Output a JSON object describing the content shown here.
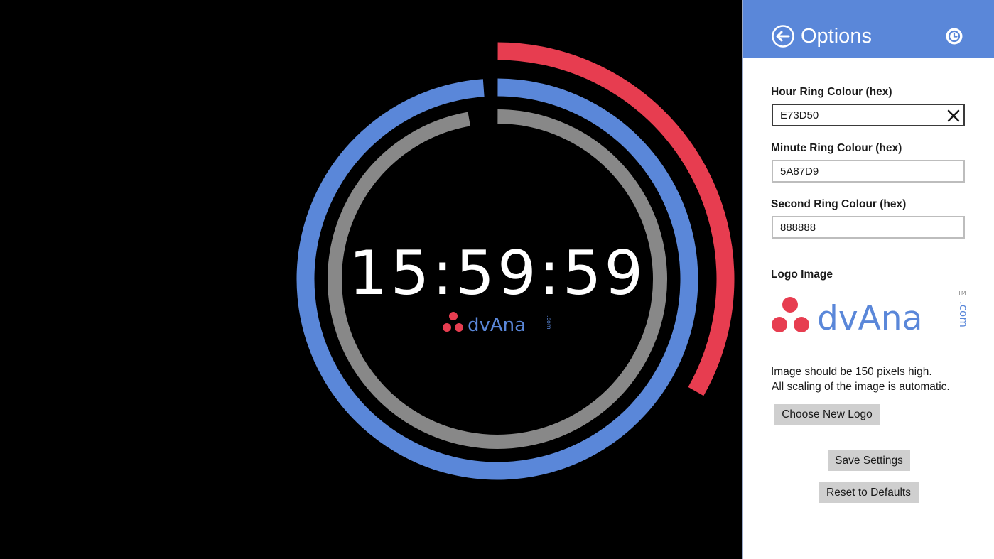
{
  "clock": {
    "time": "15:59:59",
    "hours": 15,
    "minutes": 59,
    "seconds": 59,
    "logo": {
      "mark": "dvAna",
      "suffix": ".com",
      "tm": "TM"
    }
  },
  "colors": {
    "hour_ring": "#E73D50",
    "minute_ring": "#5A87D9",
    "second_ring": "#888888",
    "header_bg": "#5A87D9",
    "logo_dots": "#E73D50",
    "logo_text": "#5A87D9"
  },
  "options": {
    "title": "Options",
    "back_icon": "back-arrow-icon",
    "clock_icon": "clock-icon",
    "hour_ring": {
      "label": "Hour Ring Colour (hex)",
      "value": "E73D50"
    },
    "minute_ring": {
      "label": "Minute Ring Colour (hex)",
      "value": "5A87D9"
    },
    "second_ring": {
      "label": "Second Ring Colour (hex)",
      "value": "888888"
    },
    "logo_image_label": "Logo Image",
    "help_line1": "Image should be 150 pixels high.",
    "help_line2": "All scaling of the image is automatic.",
    "choose_logo_button": "Choose New Logo",
    "save_button": "Save Settings",
    "reset_button": "Reset to Defaults"
  }
}
